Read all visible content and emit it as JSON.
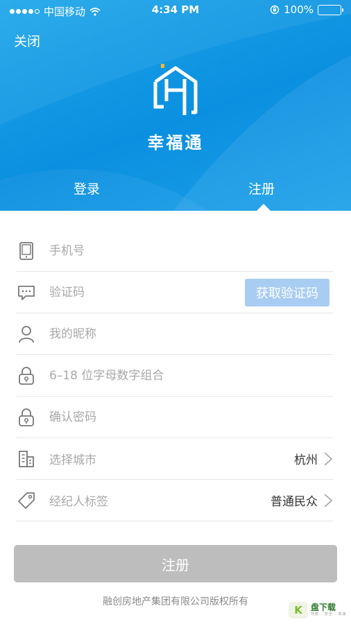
{
  "status_bar": {
    "carrier": "中国移动",
    "time": "4:34 PM",
    "battery": "100%"
  },
  "header": {
    "close_label": "关闭",
    "app_name": "幸福通",
    "tabs": [
      {
        "label": "登录",
        "active": false
      },
      {
        "label": "注册",
        "active": true
      }
    ]
  },
  "form": {
    "phone": {
      "placeholder": "手机号",
      "icon": "phone-icon"
    },
    "code": {
      "placeholder": "验证码",
      "icon": "message-icon",
      "button_label": "获取验证码"
    },
    "nickname": {
      "placeholder": "我的昵称",
      "icon": "user-icon"
    },
    "password": {
      "placeholder": "6–18 位字母数字组合",
      "icon": "lock-icon"
    },
    "confirm_password": {
      "placeholder": "确认密码",
      "icon": "lock-icon"
    },
    "city": {
      "placeholder": "选择城市",
      "value": "杭州",
      "icon": "building-icon"
    },
    "tag": {
      "placeholder": "经纪人标签",
      "value": "普通民众",
      "icon": "tag-icon"
    },
    "submit_label": "注册"
  },
  "footer": "融创房地产集团有限公司版权所有",
  "watermark": {
    "title": "盘下载",
    "subtitle": "导航 · 安全 · 高速"
  },
  "colors": {
    "header_blue": "#0b8fe0",
    "code_button": "#a9cdf2",
    "submit_disabled": "#bdbdbd"
  }
}
